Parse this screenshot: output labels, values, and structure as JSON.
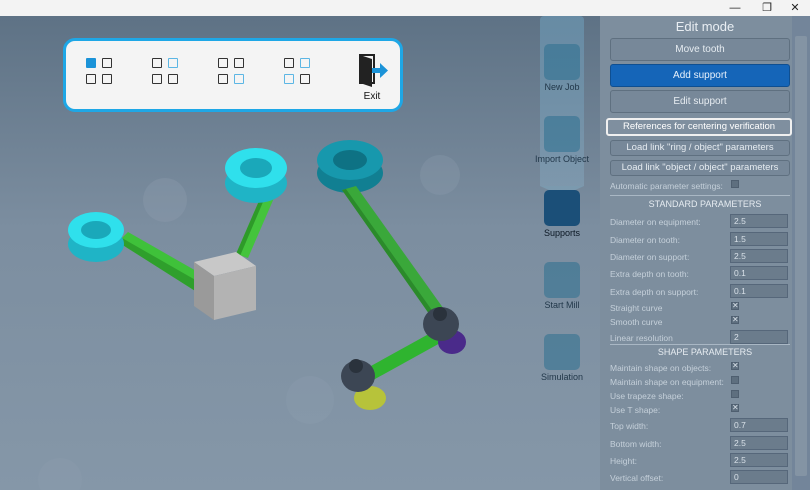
{
  "window": {
    "minimize_icon": "minimize-icon",
    "restore_icon": "restore-icon",
    "close_icon": "close-icon"
  },
  "viewbar": {
    "buttons": [
      {
        "name": "view-layout-1-button",
        "pattern": "one-active"
      },
      {
        "name": "view-layout-2-button",
        "pattern": "top-right-blue"
      },
      {
        "name": "view-layout-3-button",
        "pattern": "bottom-right-blue"
      },
      {
        "name": "view-layout-4-button",
        "pattern": "right-blue"
      }
    ],
    "exit_label": "Exit"
  },
  "tools": [
    {
      "label": "New Job",
      "icon": "new-job-icon",
      "active": false
    },
    {
      "label": "Import Object",
      "icon": "folder-icon",
      "active": false
    },
    {
      "label": "Supports",
      "icon": "supports-icon",
      "active": true
    },
    {
      "label": "Start Mill",
      "icon": "mill-icon",
      "active": false
    },
    {
      "label": "Simulation",
      "icon": "simulation-icon",
      "active": false
    }
  ],
  "panel": {
    "title": "Edit mode",
    "move_tooth": "Move tooth",
    "add_support": "Add support",
    "edit_support": "Edit support",
    "references": "References for centering verification",
    "load_ring": "Load link \"ring / object\" parameters",
    "load_object": "Load link \"object / object\" parameters",
    "auto_label": "Automatic parameter settings:",
    "auto_checked": false,
    "standard_title": "STANDARD PARAMETERS",
    "standard": [
      {
        "label": "Diameter on equipment:",
        "value": "2.5"
      },
      {
        "label": "Diameter on tooth:",
        "value": "1.5"
      },
      {
        "label": "Diameter on support:",
        "value": "2.5"
      },
      {
        "label": "Extra depth on tooth:",
        "value": "0.1"
      },
      {
        "label": "Extra depth on support:",
        "value": "0.1"
      }
    ],
    "straight_label": "Straight curve",
    "straight_mark": "✕",
    "smooth_label": "Smooth curve",
    "smooth_mark": "✕",
    "linear_label": "Linear resolution",
    "linear_value": "2",
    "shape_title": "SHAPE PARAMETERS",
    "shape_checks": [
      {
        "label": "Maintain shape on objects:",
        "mark": "✕"
      },
      {
        "label": "Maintain shape on equipment:",
        "mark": ""
      },
      {
        "label": "Use trapeze shape:",
        "mark": ""
      },
      {
        "label": "Use T shape:",
        "mark": "✕"
      }
    ],
    "shape_inputs": [
      {
        "label": "Top width:",
        "value": "0.7"
      },
      {
        "label": "Bottom width:",
        "value": "2.5"
      },
      {
        "label": "Height:",
        "value": "2.5"
      },
      {
        "label": "Vertical offset:",
        "value": "0"
      }
    ]
  },
  "colors": {
    "accent": "#1ea7e6",
    "active_button": "#1565b8",
    "ring": "#29d9e6",
    "support": "#3fc13a",
    "block": "#9e9e9e"
  }
}
